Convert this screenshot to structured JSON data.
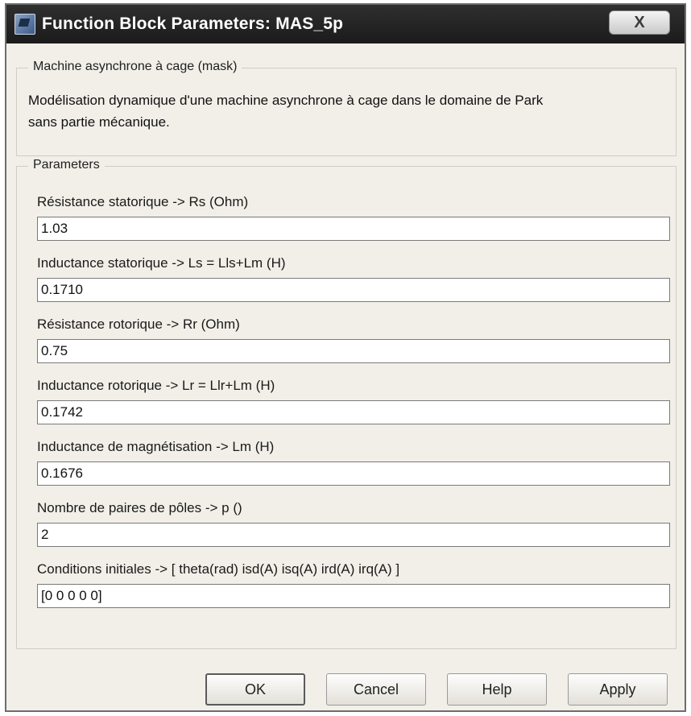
{
  "window": {
    "title": "Function Block Parameters: MAS_5p",
    "close_label": "X"
  },
  "mask": {
    "legend": "Machine asynchrone à cage (mask)",
    "description_line1": "Modélisation dynamique d'une machine asynchrone à cage dans le domaine de Park",
    "description_line2": "sans partie mécanique."
  },
  "parameters": {
    "legend": "Parameters",
    "fields": [
      {
        "label": "Résistance statorique -> Rs (Ohm)",
        "value": "1.03"
      },
      {
        "label": "Inductance statorique -> Ls = Lls+Lm (H)",
        "value": "0.1710"
      },
      {
        "label": "Résistance rotorique -> Rr (Ohm)",
        "value": "0.75"
      },
      {
        "label": "Inductance rotorique -> Lr = Llr+Lm (H)",
        "value": "0.1742"
      },
      {
        "label": "Inductance de magnétisation -> Lm (H)",
        "value": "0.1676"
      },
      {
        "label": "Nombre de paires de pôles -> p ()",
        "value": "2"
      },
      {
        "label": "Conditions initiales -> [ theta(rad) isd(A) isq(A) ird(A) irq(A) ]",
        "value": "[0 0 0 0 0]"
      }
    ]
  },
  "buttons": {
    "ok": "OK",
    "cancel": "Cancel",
    "help": "Help",
    "apply": "Apply"
  }
}
